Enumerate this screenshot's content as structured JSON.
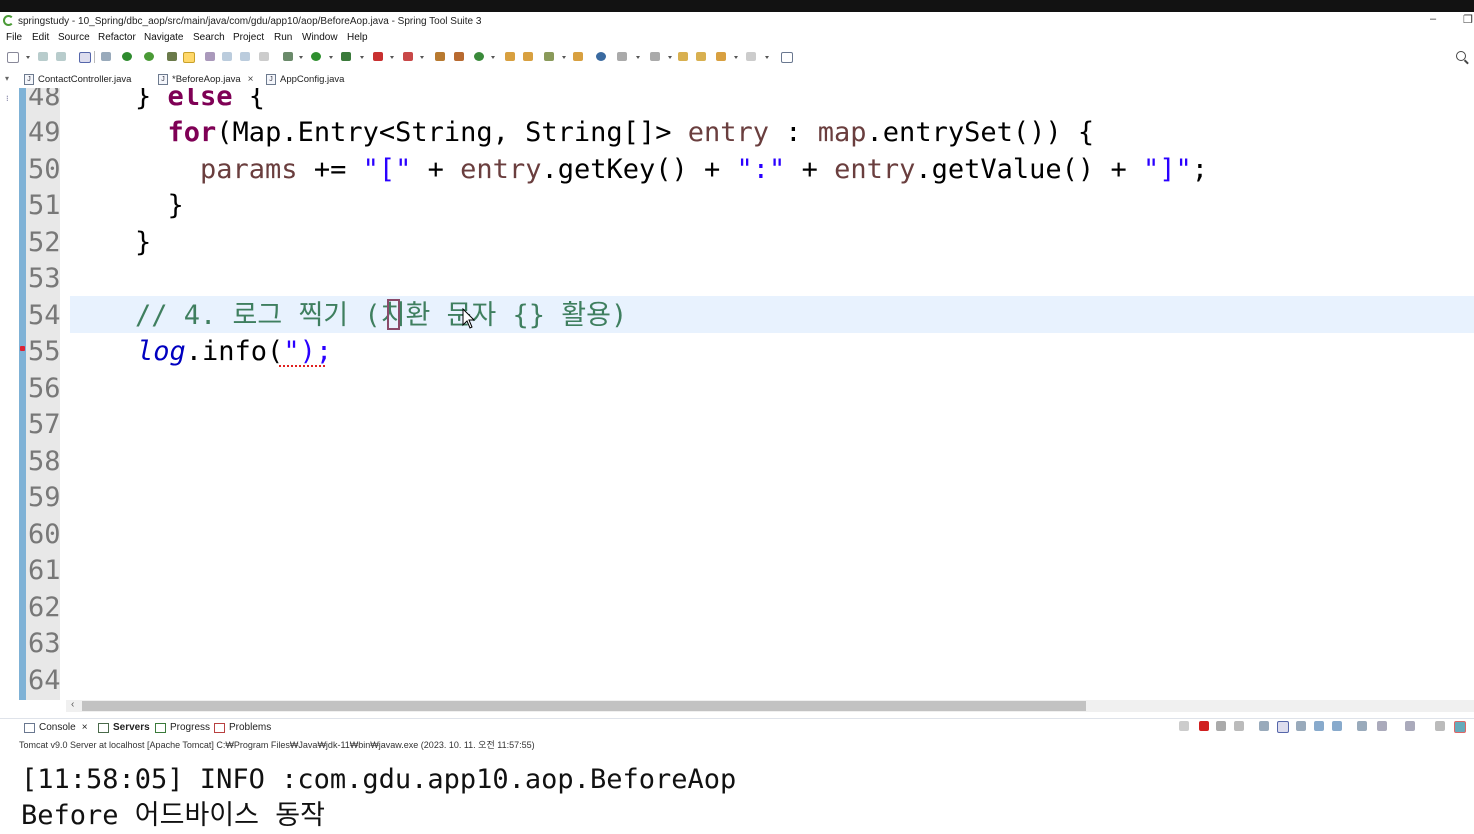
{
  "window": {
    "title": "springstudy - 10_Spring/dbc_aop/src/main/java/com/gdu/app10/aop/BeforeAop.java - Spring Tool Suite 3",
    "minimize_glyph": "–",
    "restore_glyph": "❐"
  },
  "menu": [
    "File",
    "Edit",
    "Source",
    "Refactor",
    "Navigate",
    "Search",
    "Project",
    "Run",
    "Window",
    "Help"
  ],
  "editor_tabs": [
    {
      "label": "ContactController.java",
      "active": false
    },
    {
      "label": "*BeforeAop.java",
      "active": true,
      "close": "×"
    },
    {
      "label": "AppConfig.java",
      "active": false
    }
  ],
  "line_numbers": [
    "48",
    "49",
    "50",
    "51",
    "52",
    "53",
    "54",
    "55",
    "56",
    "57",
    "58",
    "59",
    "60",
    "61",
    "62",
    "63",
    "64"
  ],
  "code": {
    "l48_a": "} ",
    "l48_kw": "else",
    "l48_b": " {",
    "l49_indent": "  ",
    "l49_kw": "for",
    "l49_a": "(Map.Entry<String, String[]> ",
    "l49_entry": "entry",
    "l49_b": " : ",
    "l49_map": "map",
    "l49_c": ".entrySet()) {",
    "l50_indent": "    ",
    "l50_params": "params",
    "l50_a": " += ",
    "l50_s1": "\"[\"",
    "l50_b": " + ",
    "l50_entry1": "entry",
    "l50_c": ".getKey() + ",
    "l50_s2": "\":\"",
    "l50_d": " + ",
    "l50_entry2": "entry",
    "l50_e": ".getValue() + ",
    "l50_s3": "\"]\"",
    "l50_f": ";",
    "l51": "  }",
    "l52": "}",
    "l54_comment": "// 4. 로그 찍기 (치환 문자 {} 활용)",
    "l55_log": "log",
    "l55_a": ".info(",
    "l55_str": "\");"
  },
  "bottom_tabs": [
    {
      "label": "Console",
      "close": "×"
    },
    {
      "label": "Servers",
      "bold": true
    },
    {
      "label": "Progress"
    },
    {
      "label": "Problems"
    }
  ],
  "console": {
    "server_info": "Tomcat v9.0 Server at localhost [Apache Tomcat] C:₩Program Files₩Java₩jdk-11₩bin₩javaw.exe  (2023. 10. 11. 오전 11:57:55)",
    "lines": [
      "[11:58:05] INFO :com.gdu.app10.aop.BeforeAop",
      "Before 어드바이스 동작"
    ]
  }
}
